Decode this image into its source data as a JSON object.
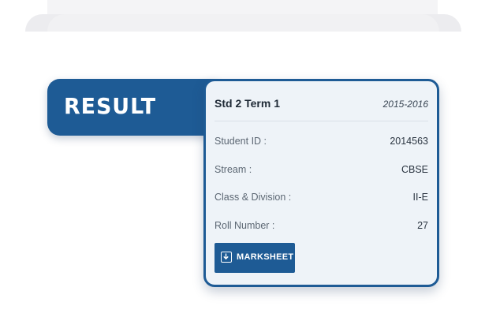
{
  "result_tab": {
    "label": "RESULT"
  },
  "card": {
    "title": "Std 2 Term 1",
    "year": "2015-2016",
    "rows": [
      {
        "label": "Student ID :",
        "value": "2014563"
      },
      {
        "label": "Stream :",
        "value": "CBSE"
      },
      {
        "label": "Class & Division :",
        "value": "II-E"
      },
      {
        "label": "Roll Number :",
        "value": "27"
      }
    ],
    "button": {
      "label": "MARKSHEET",
      "icon": "download-icon"
    }
  },
  "colors": {
    "accent": "#1e5b95",
    "card_background": "#eef3f8",
    "text_dark": "#1f2a36",
    "text_muted": "#5c6773"
  }
}
